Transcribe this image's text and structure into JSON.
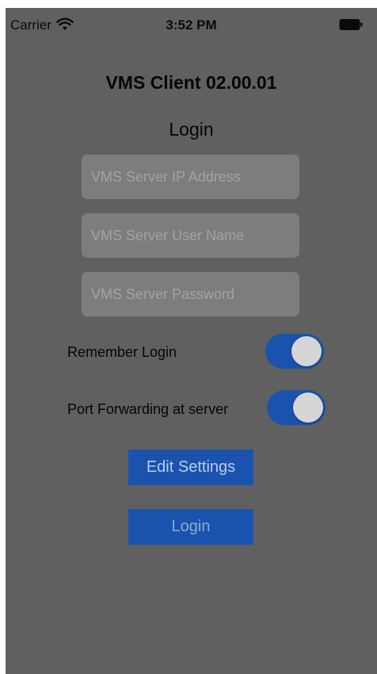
{
  "status_bar": {
    "carrier": "Carrier",
    "time": "3:52 PM",
    "wifi_icon": "wifi-icon",
    "battery_icon": "battery-icon"
  },
  "app": {
    "title": "VMS Client 02.00.01",
    "section_title": "Login"
  },
  "fields": {
    "server_ip": {
      "placeholder": "VMS Server IP Address",
      "value": ""
    },
    "user_name": {
      "placeholder": "VMS Server User Name",
      "value": ""
    },
    "password": {
      "placeholder": "VMS Server Password",
      "value": ""
    }
  },
  "toggles": {
    "remember_login": {
      "label": "Remember Login",
      "on": true
    },
    "port_forwarding": {
      "label": "Port Forwarding at server",
      "on": true
    }
  },
  "buttons": {
    "edit_settings": "Edit Settings",
    "login": "Login"
  },
  "colors": {
    "overlay_background": "#606060",
    "accent": "#1a53ad",
    "field_background": "#7d7d7d"
  }
}
